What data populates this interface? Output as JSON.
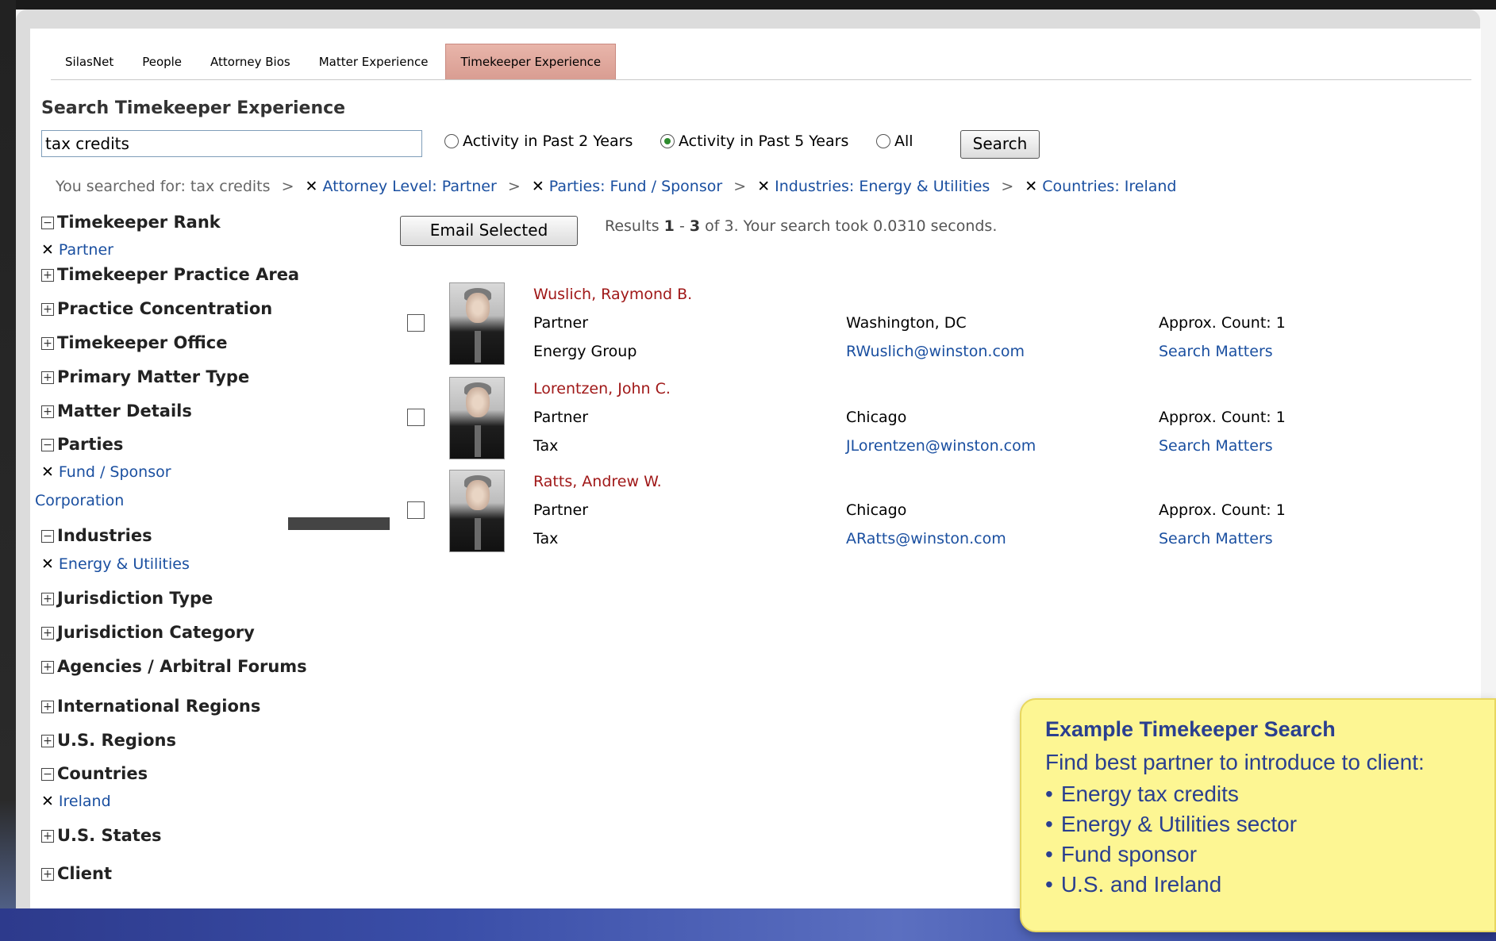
{
  "tabs": [
    "SilasNet",
    "People",
    "Attorney Bios",
    "Matter Experience",
    "Timekeeper Experience"
  ],
  "search": {
    "title": "Search Timekeeper Experience",
    "value": "tax credits",
    "radios": [
      {
        "label": "Activity in Past 2 Years",
        "checked": false
      },
      {
        "label": "Activity in Past 5 Years",
        "checked": true
      },
      {
        "label": "All",
        "checked": false
      }
    ],
    "button": "Search"
  },
  "breadcrumbs": {
    "prefix": "You searched for: tax credits",
    "separator": ">",
    "remove_glyph": "✕",
    "filters": [
      "Attorney Level: Partner",
      "Parties: Fund / Sponsor",
      "Industries: Energy & Utilities",
      "Countries: Ireland"
    ]
  },
  "facets": [
    {
      "label": "Timekeeper Rank",
      "expanded": true
    },
    {
      "label": "Partner",
      "selected_value": true
    },
    {
      "label": "Timekeeper Practice Area",
      "expanded": false
    },
    {
      "label": "Practice Concentration",
      "expanded": false
    },
    {
      "label": "Timekeeper Office",
      "expanded": false
    },
    {
      "label": "Primary Matter Type",
      "expanded": false
    },
    {
      "label": "Matter Details",
      "expanded": false
    },
    {
      "label": "Parties",
      "expanded": true
    },
    {
      "label": "Fund / Sponsor",
      "selected_value": true
    },
    {
      "label": "Corporation",
      "value": true
    },
    {
      "label": "Industries",
      "expanded": true
    },
    {
      "label": "Energy & Utilities",
      "selected_value": true
    },
    {
      "label": "Jurisdiction Type",
      "expanded": false
    },
    {
      "label": "Jurisdiction Category",
      "expanded": false
    },
    {
      "label": "Agencies / Arbitral Forums",
      "expanded": false
    },
    {
      "label": "International Regions",
      "expanded": false
    },
    {
      "label": "U.S. Regions",
      "expanded": false
    },
    {
      "label": "Countries",
      "expanded": true
    },
    {
      "label": "Ireland",
      "selected_value": true
    },
    {
      "label": "U.S. States",
      "expanded": false
    },
    {
      "label": "Client",
      "expanded": false
    }
  ],
  "email_button": "Email Selected",
  "results_summary": {
    "prefix": "Results",
    "start": "1",
    "dash": "-",
    "end": "3",
    "suffix": "of 3. Your search took 0.0310 seconds."
  },
  "results": [
    {
      "name": "Wuslich, Raymond B.",
      "rank": "Partner",
      "group": "Energy Group",
      "office": "Washington, DC",
      "email": "RWuslich@winston.com",
      "count": "Approx. Count: 1",
      "search_link": "Search Matters"
    },
    {
      "name": "Lorentzen, John C.",
      "rank": "Partner",
      "group": "Tax",
      "office": "Chicago",
      "email": "JLorentzen@winston.com",
      "count": "Approx. Count: 1",
      "search_link": "Search Matters"
    },
    {
      "name": "Ratts, Andrew W.",
      "rank": "Partner",
      "group": "Tax",
      "office": "Chicago",
      "email": "ARatts@winston.com",
      "count": "Approx. Count: 1",
      "search_link": "Search Matters"
    }
  ],
  "callout": {
    "title": "Example Timekeeper Search",
    "subtitle": "Find best partner to introduce to client:",
    "bullet": "•",
    "items": [
      "Energy tax credits",
      "Energy & Utilities sector",
      "Fund sponsor",
      "U.S. and Ireland"
    ]
  }
}
